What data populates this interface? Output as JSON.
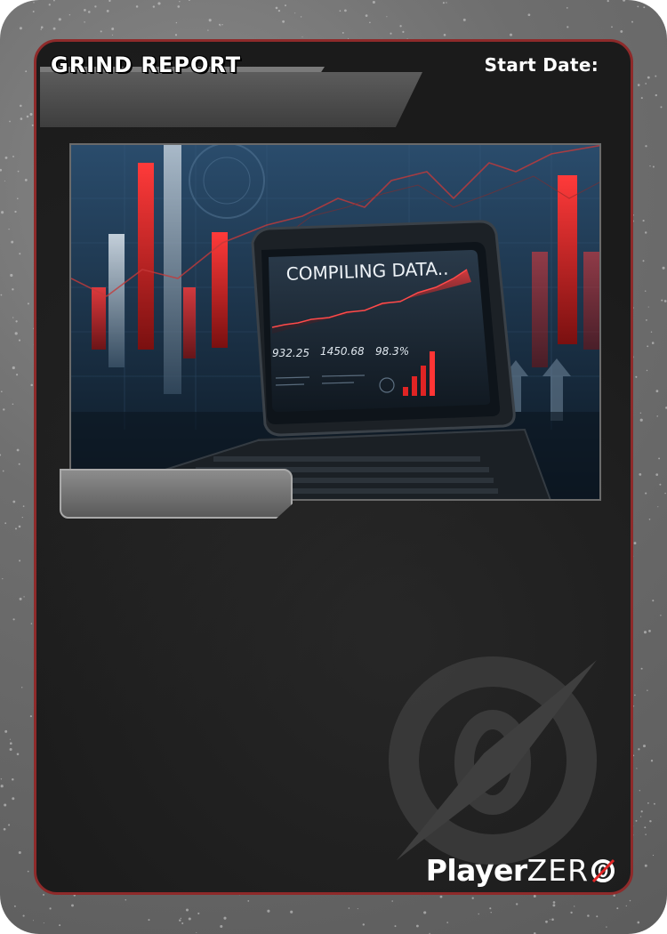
{
  "card": {
    "title": "",
    "start_date_label": "Start Date:",
    "badge_label": "GRIND REPORT",
    "brand_player": "Player",
    "brand_zero": "ZER",
    "colors": {
      "border_red": "#8e2a2a",
      "card_frame": "#6e6e6e",
      "card_inner": "#1b1b1b",
      "accent_red": "#e02424"
    }
  },
  "art": {
    "screen_heading": "COMPILING DATA..",
    "stat_1": "932.25",
    "stat_2": "1450.68",
    "stat_3": "98.3%"
  }
}
